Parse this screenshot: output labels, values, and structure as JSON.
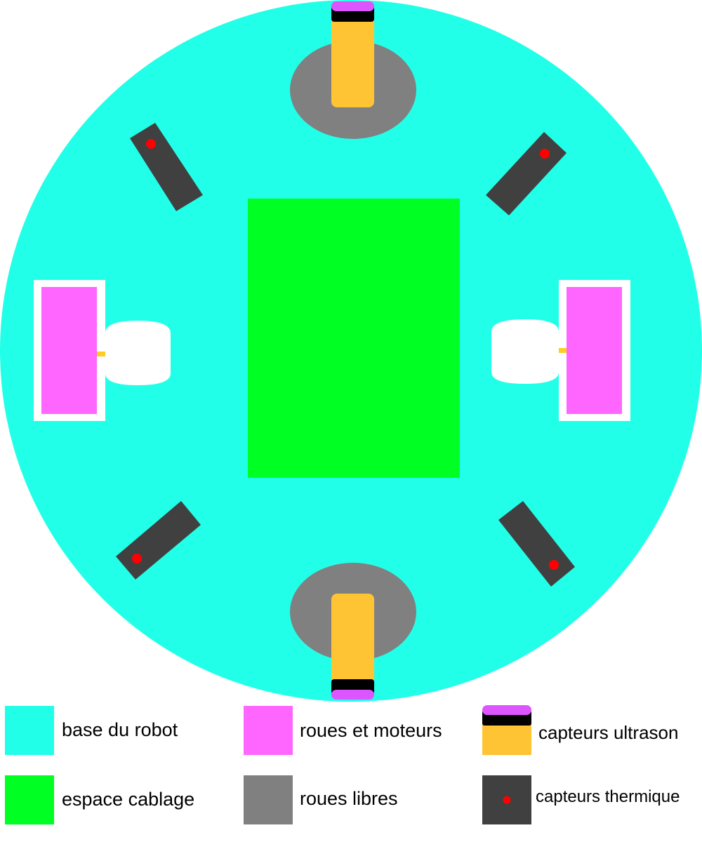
{
  "colors": {
    "base": "#22ffe8",
    "cabling": "#00ff22",
    "wheels_motors": "#ff66ff",
    "free_wheels": "#808080",
    "ultrasonic_body": "#ffc433",
    "ultrasonic_cap": "#dd55ff",
    "ultrasonic_band": "#000000",
    "thermal_body": "#404040",
    "thermal_dot": "#ff0000",
    "motor_frame": "#ffffff",
    "axle": "#ffcc22"
  },
  "legend": {
    "base_label": "base du robot",
    "cabling_label": "espace cablage",
    "wheels_label": "roues et moteurs",
    "free_wheels_label": "roues libres",
    "ultrasonic_label": "capteurs ultrason",
    "thermal_label": "capteurs thermique"
  }
}
